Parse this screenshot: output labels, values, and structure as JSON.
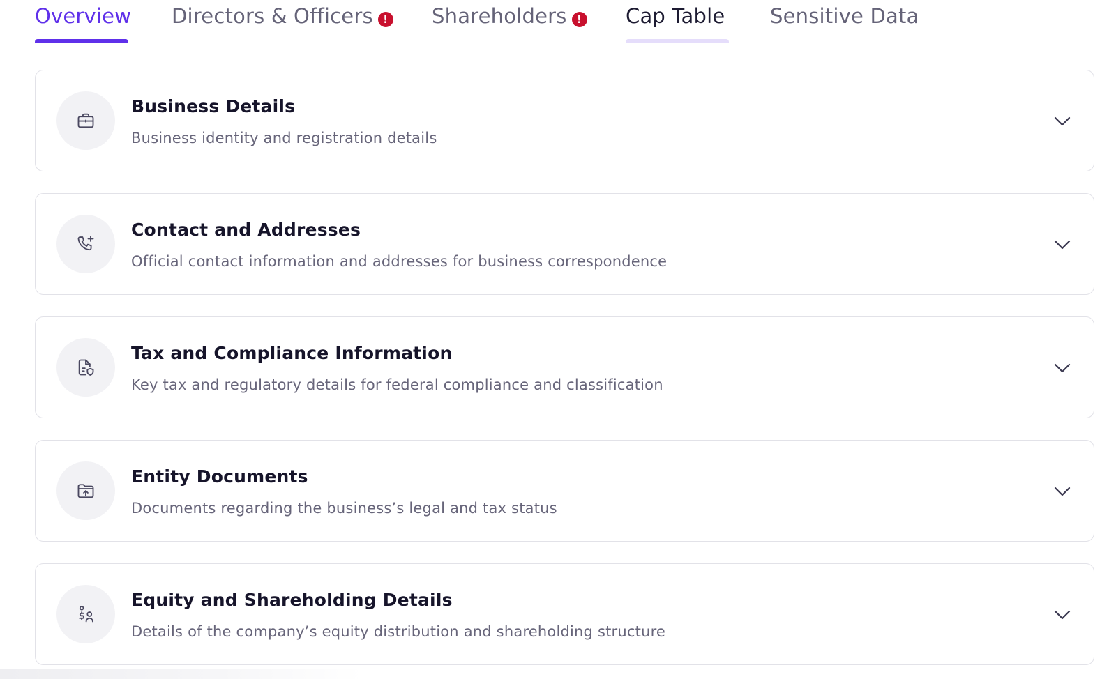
{
  "tabs": [
    {
      "label": "Overview",
      "state": "active",
      "alert": false
    },
    {
      "label": "Directors & Officers",
      "state": "normal",
      "alert": true
    },
    {
      "label": "Shareholders",
      "state": "normal",
      "alert": true
    },
    {
      "label": "Cap Table",
      "state": "hover",
      "alert": false
    },
    {
      "label": "Sensitive Data",
      "state": "normal",
      "alert": false
    }
  ],
  "alert_glyph": "!",
  "sections": [
    {
      "title": "Business Details",
      "description": "Business identity and registration details",
      "icon": "briefcase-icon"
    },
    {
      "title": "Contact and Addresses",
      "description": "Official contact information and addresses for business correspondence",
      "icon": "phone-plus-icon"
    },
    {
      "title": "Tax and Compliance Information",
      "description": "Key tax and regulatory details for federal compliance and classification",
      "icon": "document-shield-icon"
    },
    {
      "title": "Entity Documents",
      "description": "Documents regarding the business’s legal and tax status",
      "icon": "folder-upload-icon"
    },
    {
      "title": "Equity and Shareholding Details",
      "description": "Details of the company’s equity distribution and shareholding structure",
      "icon": "equity-users-icon"
    }
  ],
  "colors": {
    "accent": "#5f30ea",
    "alert": "#c8102e",
    "hover_underline": "#e5ddfb"
  }
}
